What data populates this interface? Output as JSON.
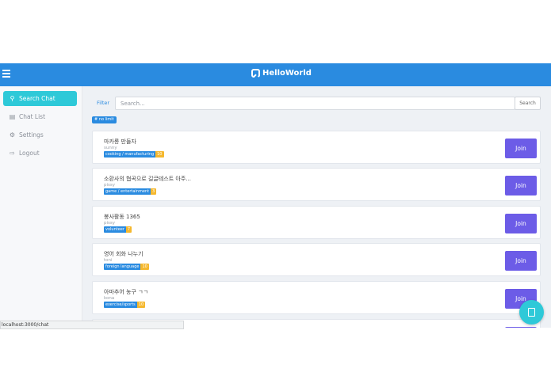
{
  "header": {
    "brand": "HelloWorld"
  },
  "sidebar": {
    "items": [
      {
        "label": "Search Chat",
        "icon": "search-icon"
      },
      {
        "label": "Chat List",
        "icon": "chat-list-icon"
      },
      {
        "label": "Settings",
        "icon": "gear-icon"
      },
      {
        "label": "Logout",
        "icon": "logout-icon"
      }
    ]
  },
  "filter": {
    "label": "Filter",
    "placeholder": "Search...",
    "button": "Search",
    "tag": "# no limit"
  },
  "rooms": [
    {
      "title": "마카롱 만들자",
      "author": "sunny",
      "tag": "cooking / manufacturing",
      "count": "10",
      "join": "Join"
    },
    {
      "title": "소환사의 협곡으로 길글테스트 아주...",
      "author": "pissy",
      "tag": "game / entertainment",
      "count": "3",
      "join": "Join"
    },
    {
      "title": "봉사활동 1365",
      "author": "pissy",
      "tag": "volunteer",
      "count": "7",
      "join": "Join"
    },
    {
      "title": "영어 회화 나누기",
      "author": "toni",
      "tag": "foreign language",
      "count": "10",
      "join": "Join"
    },
    {
      "title": "아마추어 농구 ㄱㄱ",
      "author": "kona",
      "tag": "exercise/sports",
      "count": "10",
      "join": "Join"
    }
  ],
  "status_bar": {
    "url": "localhost:3000/chat"
  },
  "colors": {
    "primary": "#2a8be0",
    "accent": "#2ec9d8",
    "join": "#6c5ce7",
    "count_badge": "#f5b82e"
  }
}
